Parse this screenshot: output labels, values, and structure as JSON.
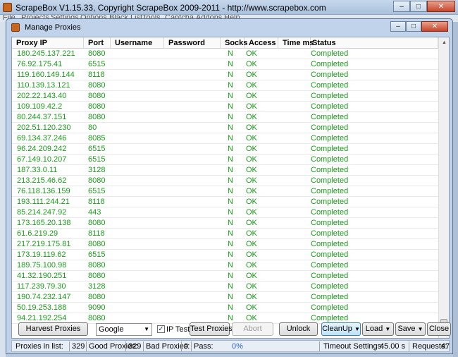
{
  "app": {
    "title": "ScrapeBox V1.15.33, Copyright ScrapeBox 2009-2011 - http://www.scrapebox.com",
    "menu": [
      "File",
      "Projects",
      "Settings",
      "Options",
      "Black List",
      "Tools",
      "Captcha",
      "Addons",
      "Help"
    ]
  },
  "dialog": {
    "title": "Manage Proxies",
    "columns": [
      "Proxy IP",
      "Port",
      "Username",
      "Password",
      "Socks",
      "Access",
      "Time ms",
      "Status"
    ],
    "rows": [
      {
        "ip": "180.245.137.221",
        "port": "8080",
        "socks": "N",
        "access": "OK",
        "status": "Completed"
      },
      {
        "ip": "76.92.175.41",
        "port": "6515",
        "socks": "N",
        "access": "OK",
        "status": "Completed"
      },
      {
        "ip": "119.160.149.144",
        "port": "8118",
        "socks": "N",
        "access": "OK",
        "status": "Completed"
      },
      {
        "ip": "110.139.13.121",
        "port": "8080",
        "socks": "N",
        "access": "OK",
        "status": "Completed"
      },
      {
        "ip": "202.22.143.40",
        "port": "8080",
        "socks": "N",
        "access": "OK",
        "status": "Completed"
      },
      {
        "ip": "109.109.42.2",
        "port": "8080",
        "socks": "N",
        "access": "OK",
        "status": "Completed"
      },
      {
        "ip": "80.244.37.151",
        "port": "8080",
        "socks": "N",
        "access": "OK",
        "status": "Completed"
      },
      {
        "ip": "202.51.120.230",
        "port": "80",
        "socks": "N",
        "access": "OK",
        "status": "Completed"
      },
      {
        "ip": "69.134.37.246",
        "port": "8085",
        "socks": "N",
        "access": "OK",
        "status": "Completed"
      },
      {
        "ip": "96.24.209.242",
        "port": "6515",
        "socks": "N",
        "access": "OK",
        "status": "Completed"
      },
      {
        "ip": "67.149.10.207",
        "port": "6515",
        "socks": "N",
        "access": "OK",
        "status": "Completed"
      },
      {
        "ip": "187.33.0.11",
        "port": "3128",
        "socks": "N",
        "access": "OK",
        "status": "Completed"
      },
      {
        "ip": "213.215.46.62",
        "port": "8080",
        "socks": "N",
        "access": "OK",
        "status": "Completed"
      },
      {
        "ip": "76.118.136.159",
        "port": "6515",
        "socks": "N",
        "access": "OK",
        "status": "Completed"
      },
      {
        "ip": "193.111.244.21",
        "port": "8118",
        "socks": "N",
        "access": "OK",
        "status": "Completed"
      },
      {
        "ip": "85.214.247.92",
        "port": "443",
        "socks": "N",
        "access": "OK",
        "status": "Completed"
      },
      {
        "ip": "173.165.20.138",
        "port": "8080",
        "socks": "N",
        "access": "OK",
        "status": "Completed"
      },
      {
        "ip": "61.6.219.29",
        "port": "8118",
        "socks": "N",
        "access": "OK",
        "status": "Completed"
      },
      {
        "ip": "217.219.175.81",
        "port": "8080",
        "socks": "N",
        "access": "OK",
        "status": "Completed"
      },
      {
        "ip": "173.19.119.62",
        "port": "6515",
        "socks": "N",
        "access": "OK",
        "status": "Completed"
      },
      {
        "ip": "189.75.100.98",
        "port": "8080",
        "socks": "N",
        "access": "OK",
        "status": "Completed"
      },
      {
        "ip": "41.32.190.251",
        "port": "8080",
        "socks": "N",
        "access": "OK",
        "status": "Completed"
      },
      {
        "ip": "117.239.79.30",
        "port": "3128",
        "socks": "N",
        "access": "OK",
        "status": "Completed"
      },
      {
        "ip": "190.74.232.147",
        "port": "8080",
        "socks": "N",
        "access": "OK",
        "status": "Completed"
      },
      {
        "ip": "50.19.253.188",
        "port": "9090",
        "socks": "N",
        "access": "OK",
        "status": "Completed"
      },
      {
        "ip": "94.21.192.254",
        "port": "8080",
        "socks": "N",
        "access": "OK",
        "status": "Completed"
      }
    ],
    "toolbar": {
      "harvest": "Harvest Proxies",
      "engine": "Google",
      "ip_test_label": "IP Test",
      "ip_test_checked": true,
      "test": "Test Proxies",
      "abort": "Abort",
      "unlock": "Unlock",
      "cleanup": "CleanUp",
      "load": "Load",
      "save": "Save",
      "close": "Close"
    },
    "status": {
      "proxies_label": "Proxies in list:",
      "proxies_value": "329",
      "good_label": "Good Proxies:",
      "good_value": "329",
      "bad_label": "Bad Proxies:",
      "bad_value": "0",
      "pass_label": "Pass:",
      "pass_percent": "0%",
      "timeout_label": "Timeout Settings:",
      "timeout_value": "45.00 s",
      "requests_label": "Requests:",
      "requests_value": "47"
    }
  },
  "colors": {
    "ok_text": "#1a9a1a",
    "dialog_frame": "#c0d3ea"
  }
}
